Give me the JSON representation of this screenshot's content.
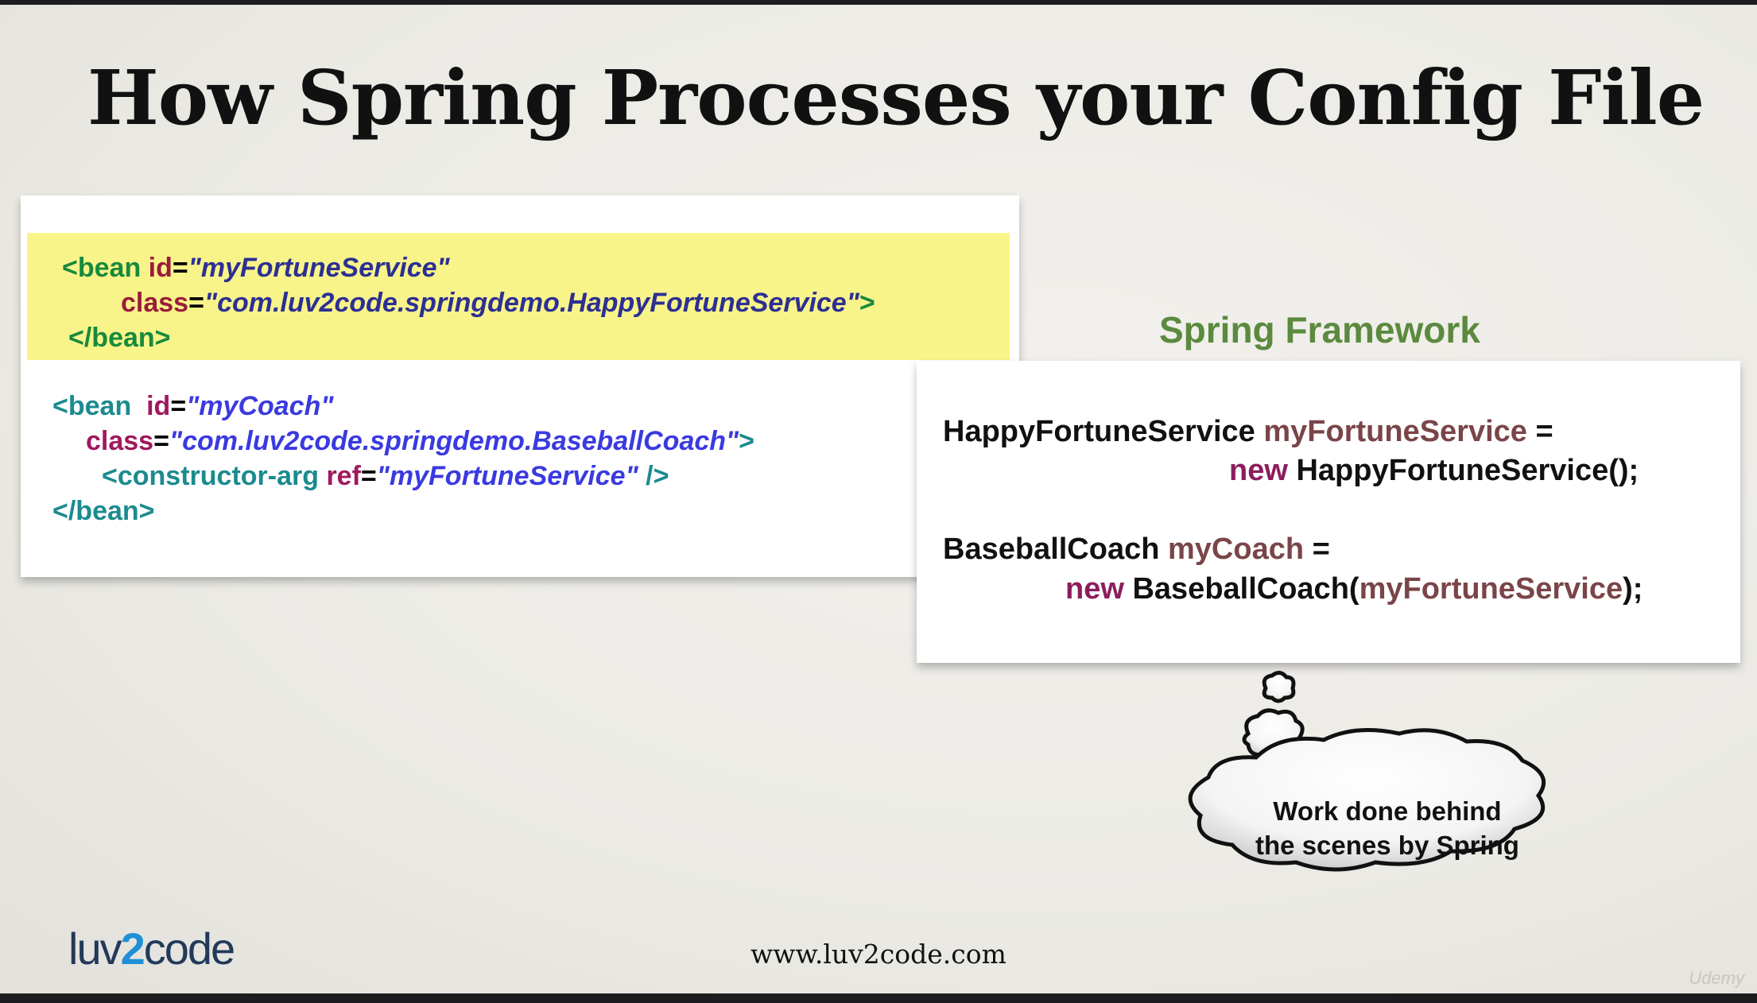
{
  "slide": {
    "title": "How Spring Processes your Config File",
    "framework_label": "Spring Framework",
    "xml": {
      "bean1": {
        "open": "<bean ",
        "id_attr": "id",
        "eq": "=",
        "id_val": "\"myFortuneService\"",
        "class_attr": "class",
        "class_val": "\"com.luv2code.springdemo.HappyFortuneService\"",
        "gt": ">",
        "close": "</bean>"
      },
      "bean2": {
        "open": "<bean  ",
        "id_attr": "id",
        "eq": "=",
        "id_val": "\"myCoach\"",
        "class_attr": "class",
        "class_val": "\"com.luv2code.springdemo.BaseballCoach\"",
        "gt": ">",
        "ctor_open": "<constructor-arg ",
        "ref_attr": "ref",
        "ref_val": "\"myFortuneService\"",
        "ctor_close": " />",
        "close": "</bean>"
      }
    },
    "java": {
      "line1_type": "HappyFortuneService ",
      "line1_var": "myFortuneService",
      "line1_eq": " =",
      "line2_kw": "new ",
      "line2_rest": "HappyFortuneService();",
      "line3_type": "BaseballCoach ",
      "line3_var": "myCoach",
      "line3_eq": " =",
      "line4_kw": "new ",
      "line4_call": "BaseballCoach(",
      "line4_arg": "myFortuneService",
      "line4_end": ");"
    },
    "cloud_text_line1": "Work done behind",
    "cloud_text_line2": "the scenes by Spring",
    "logo": {
      "part1": "luv",
      "part2": "2",
      "part3": "code"
    },
    "url": "www.luv2code.com",
    "watermark": "Udemy"
  },
  "colors": {
    "highlight": "#f8f48a",
    "framework_label": "#5b8a3e",
    "tag": "#178a3c",
    "attr": "#9b1c3a",
    "value": "#2c2f93",
    "java_var": "#7a4548",
    "java_keyword": "#8b1d5e"
  }
}
